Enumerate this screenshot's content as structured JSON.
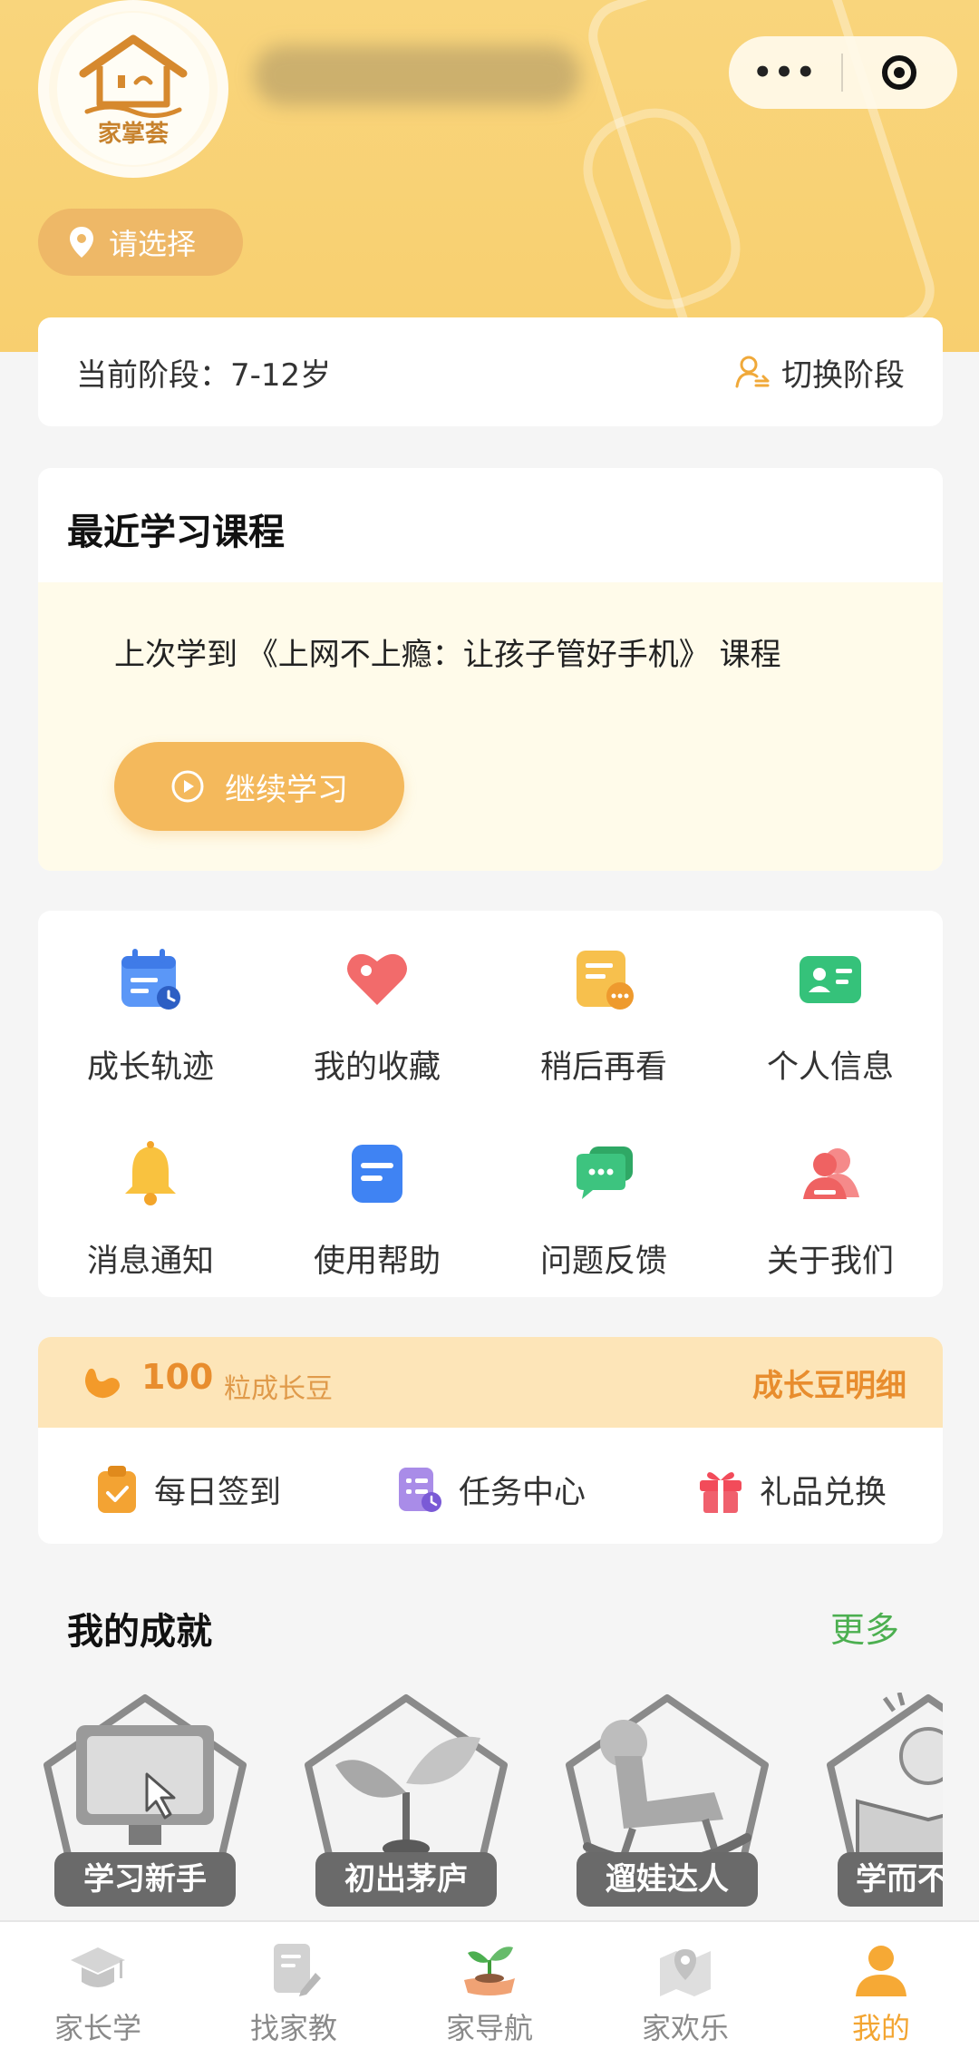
{
  "header": {
    "logo_text": "家掌荟",
    "location_label": "请选择",
    "capsule_more": "•••"
  },
  "stage": {
    "current_label": "当前阶段：7-12岁",
    "switch_label": "切换阶段"
  },
  "recent_course": {
    "title": "最近学习课程",
    "last_learned": "上次学到 《上网不上瘾：让孩子管好手机》 课程",
    "continue_label": "继续学习"
  },
  "menu": {
    "items": [
      {
        "label": "成长轨迹",
        "icon": "calendar-icon",
        "color": "#4e8ef7"
      },
      {
        "label": "我的收藏",
        "icon": "heart-tag-icon",
        "color": "#f05a5a"
      },
      {
        "label": "稍后再看",
        "icon": "note-later-icon",
        "color": "#f5b43b"
      },
      {
        "label": "个人信息",
        "icon": "id-card-icon",
        "color": "#2fbf71"
      },
      {
        "label": "消息通知",
        "icon": "bell-icon",
        "color": "#f8b72e"
      },
      {
        "label": "使用帮助",
        "icon": "help-doc-icon",
        "color": "#3d7ff2"
      },
      {
        "label": "问题反馈",
        "icon": "chat-bubble-icon",
        "color": "#31c479"
      },
      {
        "label": "关于我们",
        "icon": "people-icon",
        "color": "#f06767"
      }
    ]
  },
  "beans": {
    "count": "100",
    "unit_label": "粒成长豆",
    "detail_label": "成长豆明细",
    "actions": [
      {
        "label": "每日签到",
        "icon": "clipboard-check-icon"
      },
      {
        "label": "任务中心",
        "icon": "task-list-icon"
      },
      {
        "label": "礼品兑换",
        "icon": "gift-icon"
      }
    ]
  },
  "achievements": {
    "title": "我的成就",
    "more_label": "更多",
    "badges": [
      {
        "label": "学习新手",
        "icon": "monitor-badge-icon"
      },
      {
        "label": "初出茅庐",
        "icon": "sprout-badge-icon"
      },
      {
        "label": "遛娃达人",
        "icon": "rocking-horse-badge-icon"
      },
      {
        "label": "学而不",
        "icon": "book-bulb-badge-icon"
      }
    ]
  },
  "tabbar": {
    "tabs": [
      {
        "label": "家长学",
        "icon": "graduation-cap-icon",
        "active": false
      },
      {
        "label": "找家教",
        "icon": "document-pen-icon",
        "active": false
      },
      {
        "label": "家导航",
        "icon": "sprout-hand-icon",
        "active": false
      },
      {
        "label": "家欢乐",
        "icon": "map-pin-icon",
        "active": false
      },
      {
        "label": "我的",
        "icon": "person-icon",
        "active": true
      }
    ]
  }
}
